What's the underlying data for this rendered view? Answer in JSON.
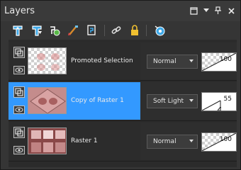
{
  "panel": {
    "title": "Layers",
    "controls": [
      "restore-icon",
      "dropdown-icon",
      "pin-icon",
      "close-icon"
    ]
  },
  "toolbar": {
    "icons": [
      "new-raster-layer-icon",
      "new-vector-layer-icon",
      "new-adjustment-layer-icon",
      "paint-brush-icon",
      "copy-layer-icon",
      "link-icon",
      "lock-icon",
      "visibility-toggle-icon"
    ]
  },
  "layers": [
    {
      "name": "Promoted Selection",
      "blend_mode": "Normal",
      "opacity": "100",
      "selected": false,
      "opacity_fraction": 1.0
    },
    {
      "name": "Copy of Raster 1",
      "blend_mode": "Soft Light",
      "opacity": "55",
      "selected": true,
      "opacity_fraction": 0.55
    },
    {
      "name": "Raster 1",
      "blend_mode": "Normal",
      "opacity": "100",
      "selected": false,
      "opacity_fraction": 1.0
    }
  ],
  "colors": {
    "selection": "#3399ff",
    "panel_bg": "#353535"
  }
}
